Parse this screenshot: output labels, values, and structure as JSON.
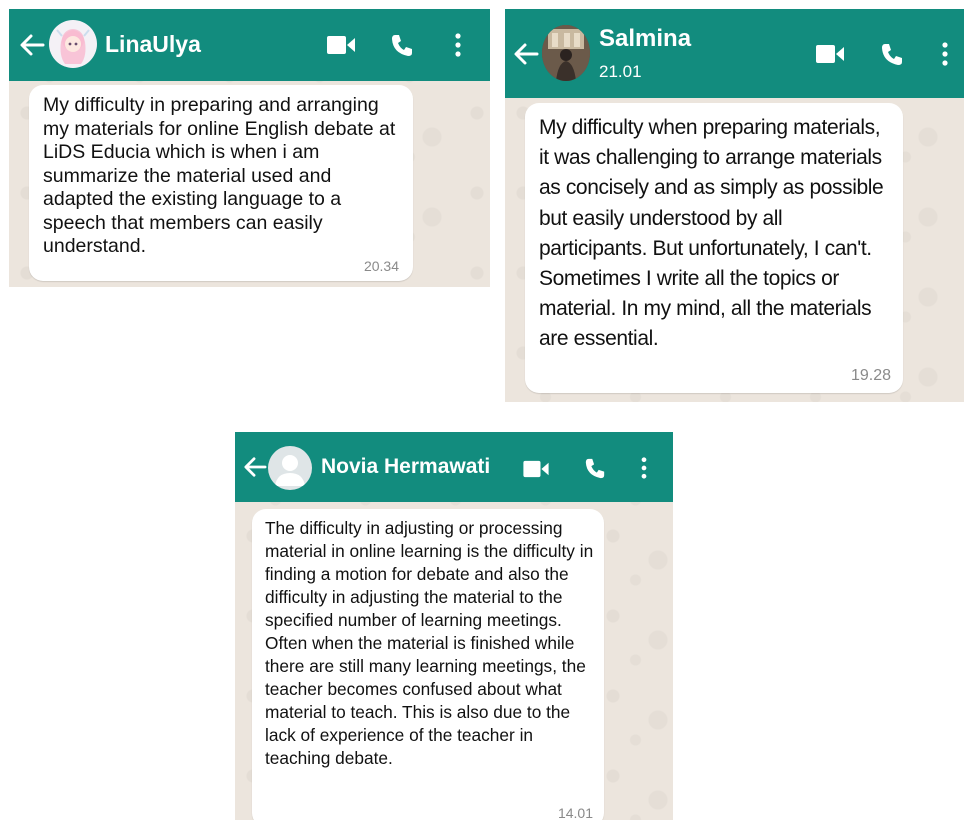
{
  "chats": [
    {
      "contact": "LinaUlya",
      "status": "",
      "message": "My difficulty in preparing and arranging my  materials for online English debate at LiDS Educia which is when i am summarize the material used and adapted the existing language to a speech that members can easily understand.",
      "time": "20.34",
      "avatar": "anime-avatar"
    },
    {
      "contact": "Salmina",
      "status": "21.01",
      "message": "My difficulty when preparing materials, it was challenging to arrange materials as concisely and as simply as possible but easily understood by all participants. But unfortunately, I can't. Sometimes I write all the topics or material. In my mind, all the materials are essential.",
      "time": "19.28",
      "avatar": "photo-avatar"
    },
    {
      "contact": "Novia Hermawati",
      "status": "",
      "message": "The difficulty in adjusting or processing material in online learning is the difficulty in finding a motion for debate and also the difficulty in adjusting the material to the specified number of learning meetings.  Often when the material is finished while there are still many learning meetings, the teacher becomes confused about what material to teach.  This is also due to the lack of experience of the teacher in teaching debate.",
      "time": "14.01",
      "avatar": "default-avatar"
    }
  ],
  "icons": [
    "back-arrow-icon",
    "video-call-icon",
    "phone-icon",
    "more-options-icon"
  ],
  "colors": {
    "header": "#128c7e",
    "chat_bg": "#ece5dd",
    "bubble": "#ffffff",
    "time": "#8a8a8a"
  }
}
